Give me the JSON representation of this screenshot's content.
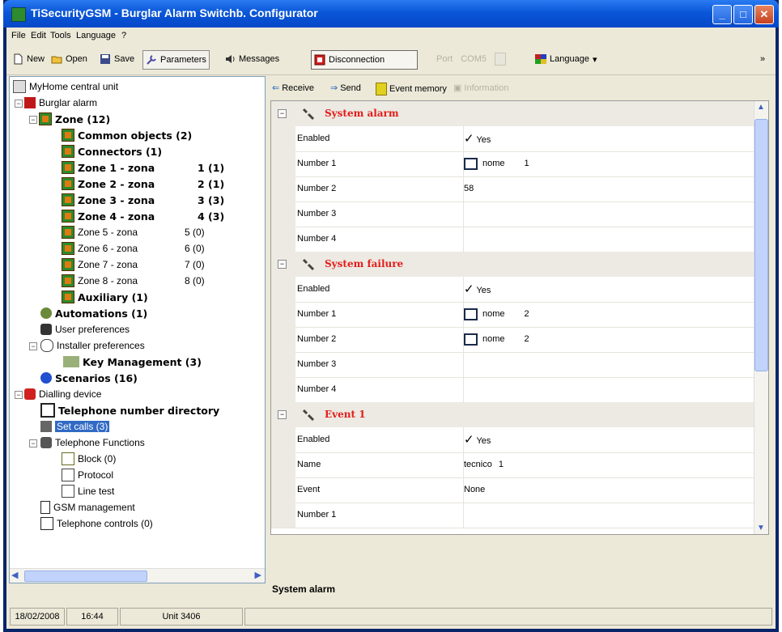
{
  "window": {
    "title": "TiSecurityGSM - Burglar Alarm Switchb. Configurator",
    "controls": {
      "minimize": "_",
      "maximize": "□",
      "close": "✕"
    }
  },
  "menu": [
    "File",
    "Edit",
    "Tools",
    "Language",
    "?"
  ],
  "toolbar": {
    "new": "New",
    "open": "Open",
    "save": "Save",
    "parameters": "Parameters",
    "messages": "Messages",
    "disconnection": "Disconnection",
    "port_label": "Port",
    "port_value": "COM5",
    "language": "Language",
    "overflow": "»"
  },
  "tree": {
    "root": "MyHome central unit",
    "burglar": "Burglar alarm",
    "zone": "Zone (12)",
    "zones": [
      {
        "label": "Common objects (2)",
        "count": ""
      },
      {
        "label": "Connectors (1)",
        "count": ""
      },
      {
        "label": "Zone 1 - zona",
        "count": "1 (1)"
      },
      {
        "label": "Zone 2 - zona",
        "count": "2 (1)"
      },
      {
        "label": "Zone 3 - zona",
        "count": "3 (3)"
      },
      {
        "label": "Zone 4 - zona",
        "count": "4 (3)"
      },
      {
        "label": "Zone 5 - zona",
        "count": "5 (0)"
      },
      {
        "label": "Zone 6 - zona",
        "count": "6 (0)"
      },
      {
        "label": "Zone 7 - zona",
        "count": "7 (0)"
      },
      {
        "label": "Zone 8 - zona",
        "count": "8 (0)"
      },
      {
        "label": "Auxiliary (1)",
        "count": ""
      }
    ],
    "automations": "Automations (1)",
    "user_prefs": "User preferences",
    "installer_prefs": "Installer preferences",
    "key_mgmt": "Key Management (3)",
    "scenarios": "Scenarios (16)",
    "dialling": "Dialling device",
    "phone_dir": "Telephone number directory",
    "set_calls": "Set calls (3)",
    "tel_functions": "Telephone Functions",
    "block": "Block (0)",
    "protocol": "Protocol",
    "line_test": "Line test",
    "gsm": "GSM management",
    "tel_controls": "Telephone controls (0)"
  },
  "right_toolbar": {
    "receive": "Receive",
    "send": "Send",
    "event_memory": "Event memory",
    "information": "Information"
  },
  "grid": {
    "sections": [
      {
        "title": "System alarm",
        "rows": [
          {
            "name": "Enabled",
            "value": "Yes",
            "check": "✓"
          },
          {
            "name": "Number 1",
            "value": "nome",
            "extra": "1"
          },
          {
            "name": "Number 2",
            "value": "58"
          },
          {
            "name": "Number 3",
            "value": ""
          },
          {
            "name": "Number 4",
            "value": ""
          }
        ]
      },
      {
        "title": "System failure",
        "rows": [
          {
            "name": "Enabled",
            "value": "Yes",
            "check": "✓"
          },
          {
            "name": "Number 1",
            "value": "nome",
            "extra": "2"
          },
          {
            "name": "Number 2",
            "value": "nome",
            "extra": "2"
          },
          {
            "name": "Number 3",
            "value": ""
          },
          {
            "name": "Number 4",
            "value": ""
          }
        ]
      },
      {
        "title": "Event 1",
        "rows": [
          {
            "name": "Enabled",
            "value": "Yes",
            "check": "✓"
          },
          {
            "name": "Name",
            "value": "tecnico",
            "extra": "1"
          },
          {
            "name": "Event",
            "value": "None"
          },
          {
            "name": "Number 1",
            "value": ""
          }
        ]
      }
    ]
  },
  "description_title": "System alarm",
  "status": {
    "date": "18/02/2008",
    "time": "16:44",
    "unit": "Unit 3406"
  }
}
